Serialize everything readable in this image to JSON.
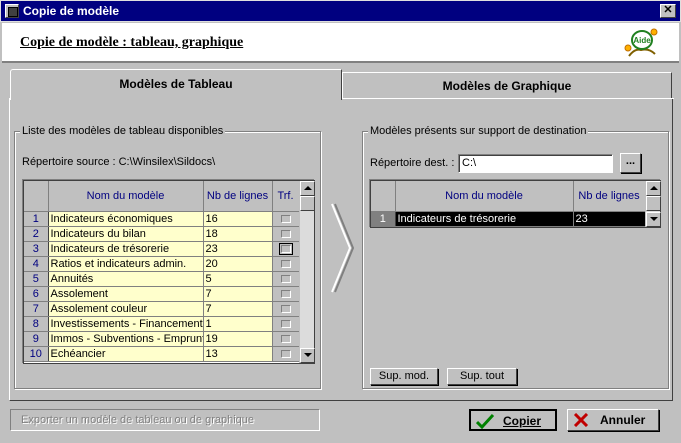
{
  "window": {
    "title": "Copie de modèle",
    "close_label": "✕"
  },
  "header": {
    "title": "Copie de modèle : tableau, graphique",
    "logo_text": "Aide"
  },
  "tabs": [
    {
      "label": "Modèles de Tableau"
    },
    {
      "label": "Modèles de Graphique"
    }
  ],
  "left": {
    "group_label": "Liste des modèles de tableau disponibles",
    "source_dir": "Répertoire source : C:\\Winsilex\\Sildocs\\",
    "columns": [
      "Nom du modèle",
      "Nb de lignes",
      "Trf."
    ],
    "rows": [
      {
        "n": "1",
        "name": "Indicateurs économiques",
        "lines": "16"
      },
      {
        "n": "2",
        "name": "Indicateurs du bilan",
        "lines": "18"
      },
      {
        "n": "3",
        "name": "Indicateurs de trésorerie",
        "lines": "23"
      },
      {
        "n": "4",
        "name": "Ratios et indicateurs admin.",
        "lines": "20"
      },
      {
        "n": "5",
        "name": "Annuités",
        "lines": "5"
      },
      {
        "n": "6",
        "name": "Assolement",
        "lines": "7"
      },
      {
        "n": "7",
        "name": "Assolement couleur",
        "lines": "7"
      },
      {
        "n": "8",
        "name": "Investissements - Financements",
        "lines": "1"
      },
      {
        "n": "9",
        "name": "Immos - Subventions - Emprunts",
        "lines": "19"
      },
      {
        "n": "10",
        "name": "Echéancier",
        "lines": "13"
      }
    ]
  },
  "right": {
    "group_label": "Modèles présents sur support de destination",
    "dest_label": "Répertoire dest. :",
    "dest_value": "C:\\",
    "browse_label": "...",
    "columns": [
      "Nom du modèle",
      "Nb de lignes"
    ],
    "rows": [
      {
        "n": "1",
        "name": "Indicateurs de trésorerie",
        "lines": "23"
      }
    ],
    "sup_mod_label": "Sup. mod.",
    "sup_tout_label": "Sup. tout"
  },
  "status": "Exporter un modèle de tableau ou de graphique",
  "buttons": {
    "copy_label": "Copier",
    "cancel_label": "Annuler"
  },
  "colors": {
    "title_bar": "#000080",
    "cell_bg": "#ffffcc",
    "row_num": "#000080"
  }
}
